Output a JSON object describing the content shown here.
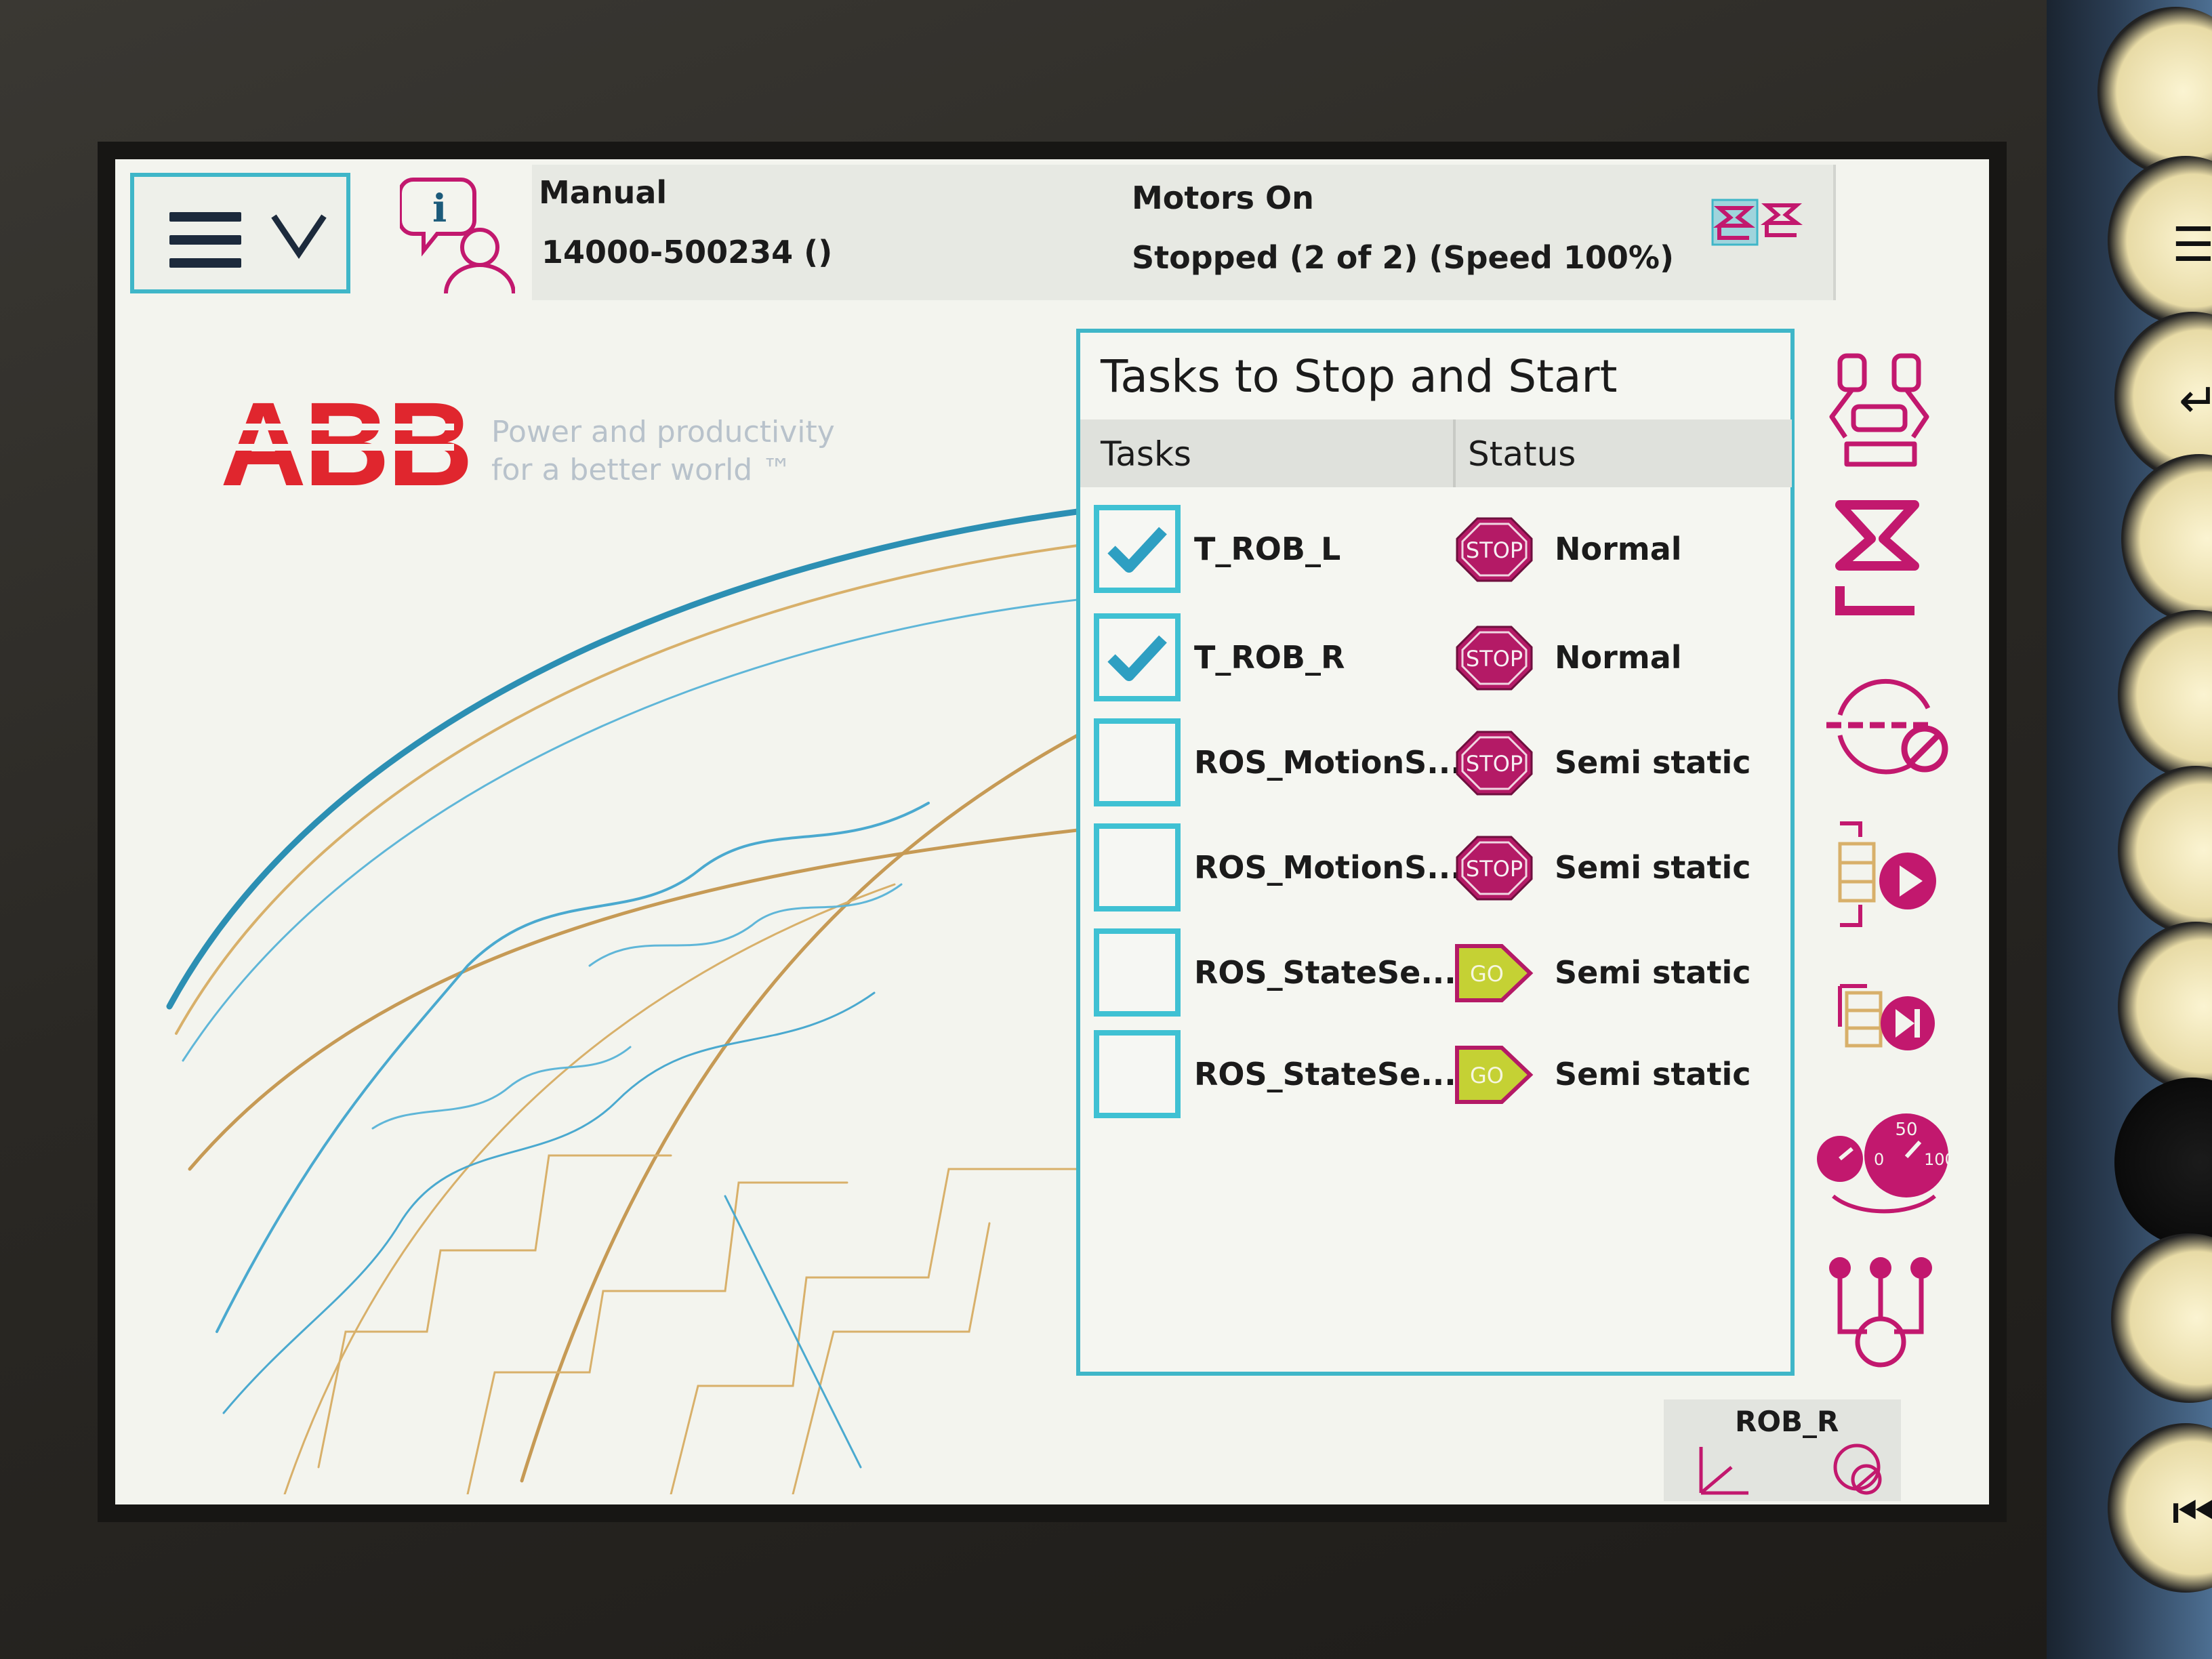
{
  "status_bar": {
    "mode": "Manual",
    "controller_name": "14000-500234 ()",
    "motors_state": "Motors On",
    "run_state": "Stopped (2 of 2) (Speed 100%)"
  },
  "branding": {
    "logo": "ABB",
    "tagline_line1": "Power and productivity",
    "tagline_line2": "for a better world ™"
  },
  "tasks_dialog": {
    "title": "Tasks to Stop and Start",
    "columns": {
      "tasks": "Tasks",
      "status": "Status"
    },
    "rows": [
      {
        "name": "T_ROB_L",
        "checked": true,
        "state_icon": "STOP",
        "status": "Normal"
      },
      {
        "name": "T_ROB_R",
        "checked": true,
        "state_icon": "STOP",
        "status": "Normal"
      },
      {
        "name": "ROS_MotionS...",
        "checked": false,
        "state_icon": "STOP",
        "status": "Semi static"
      },
      {
        "name": "ROS_MotionS...",
        "checked": false,
        "state_icon": "STOP",
        "status": "Semi static"
      },
      {
        "name": "ROS_StateSe...",
        "checked": false,
        "state_icon": "GO",
        "status": "Semi static"
      },
      {
        "name": "ROS_StateSe...",
        "checked": false,
        "state_icon": "GO",
        "status": "Semi static"
      }
    ]
  },
  "quickset": {
    "speed_min": "0",
    "speed_mid": "50",
    "speed_max": "100"
  },
  "mechanical_unit": {
    "label": "ROB_R"
  },
  "colors": {
    "accent": "#3fb6c8",
    "brand_red": "#e0262e",
    "quickset_magenta": "#c2186e",
    "stop_icon": "#b41a66",
    "go_icon": "#c5d134"
  },
  "icons": {
    "menu": "hamburger-chevron-icon",
    "event_log": "event-log-icon",
    "robot_status": "robot-state-icons",
    "checkbox": "check-icon"
  }
}
